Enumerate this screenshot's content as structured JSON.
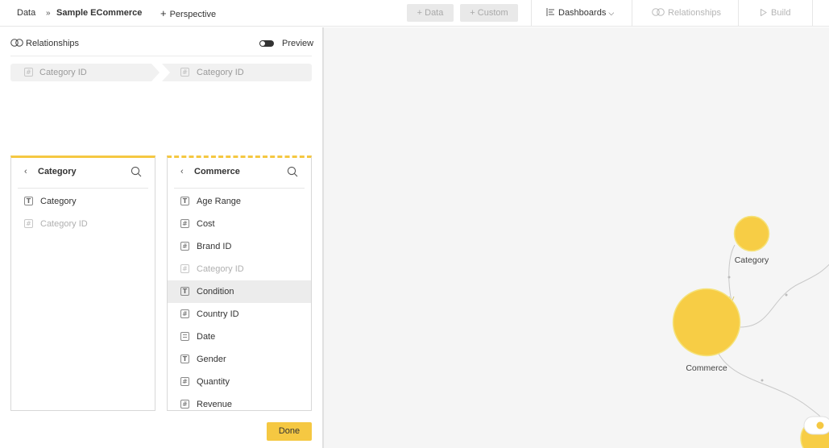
{
  "topbar": {
    "breadcrumb_root": "Data",
    "breadcrumb_sep": "»",
    "model_name": "Sample ECommerce",
    "perspective_label": "Perspective",
    "add_data_label": "+ Data",
    "add_custom_label": "+ Custom",
    "dashboards_label": "Dashboards",
    "relationships_label": "Relationships",
    "build_label": "Build"
  },
  "panel": {
    "header": "Relationships",
    "preview_label": "Preview",
    "link": {
      "left_field": "Category ID",
      "right_field": "Category ID"
    },
    "done_label": "Done"
  },
  "tables": {
    "category": {
      "title": "Category",
      "fields": [
        {
          "label": "Category",
          "type": "text"
        },
        {
          "label": "Category ID",
          "type": "number",
          "dim": true
        }
      ]
    },
    "commerce": {
      "title": "Commerce",
      "fields": [
        {
          "label": "Age Range",
          "type": "text"
        },
        {
          "label": "Cost",
          "type": "number"
        },
        {
          "label": "Brand ID",
          "type": "number"
        },
        {
          "label": "Category ID",
          "type": "number",
          "dim": true
        },
        {
          "label": "Condition",
          "type": "text",
          "highlighted": true
        },
        {
          "label": "Country ID",
          "type": "number"
        },
        {
          "label": "Date",
          "type": "date"
        },
        {
          "label": "Gender",
          "type": "text"
        },
        {
          "label": "Quantity",
          "type": "number"
        },
        {
          "label": "Revenue",
          "type": "number"
        }
      ]
    }
  },
  "canvas": {
    "nodes": {
      "category": "Category",
      "commerce": "Commerce"
    },
    "colors": {
      "node_fill": "#f7cd45",
      "node_stroke": "#f5e27a",
      "edge": "#c8c8c8"
    }
  },
  "colors": {
    "accent": "#f5c842"
  }
}
